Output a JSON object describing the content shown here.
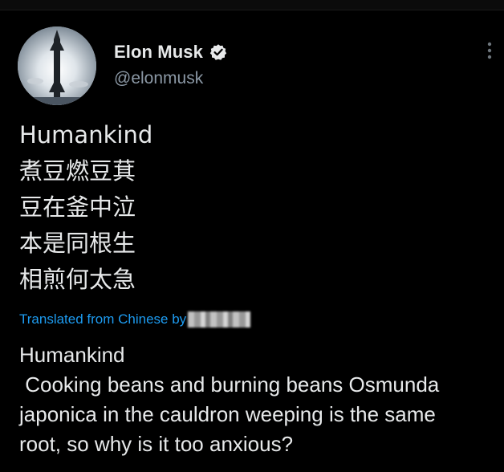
{
  "author": {
    "display_name": "Elon Musk",
    "handle": "@elonmusk",
    "verified_icon": "verified-badge-icon",
    "avatar_icon": "starship-avatar"
  },
  "tweet": {
    "lines": [
      "Humankind",
      "煮豆燃豆萁",
      "豆在釜中泣",
      "本是同根生",
      "相煎何太急"
    ]
  },
  "translation": {
    "label": "Translated from Chinese by",
    "lines": [
      "Humankind",
      " Cooking beans and burning beans Osmunda",
      "japonica in the cauldron weeping is the same",
      "root, so why is it too anxious?"
    ]
  },
  "menu": {
    "icon": "more-options-icon"
  },
  "colors": {
    "background": "#000000",
    "text": "#e7e9ea",
    "secondary": "#8b98a5",
    "link": "#1d9bf0"
  }
}
